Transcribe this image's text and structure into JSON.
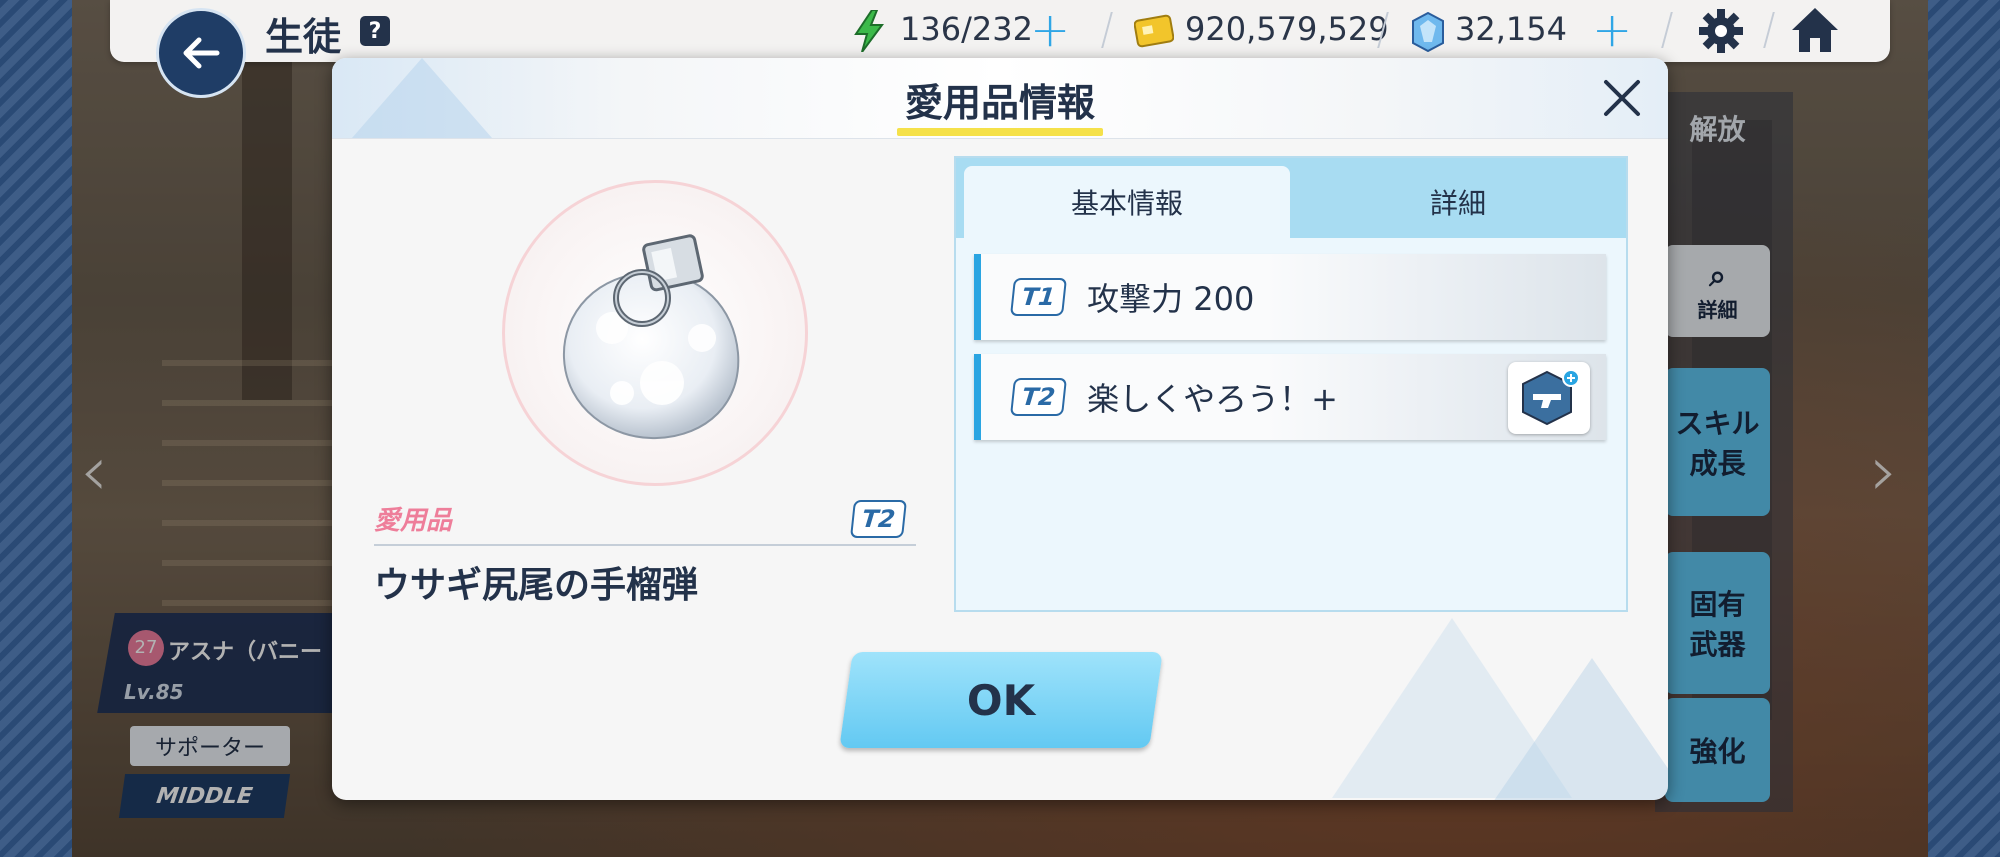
{
  "header": {
    "title": "生徒",
    "help": "?",
    "ap": "136/232",
    "credits": "920,579,529",
    "gems": "32,154"
  },
  "background": {
    "side_release": "解放",
    "side_detail": "詳細",
    "side_skill": "スキル\n成長",
    "side_weapon": "固有\n武器",
    "side_enhance": "強化",
    "character_level_badge": "27",
    "character_name": "アスナ（バニー",
    "character_level": "Lv.85",
    "supporter_label": "サポーター",
    "position_label": "MIDDLE"
  },
  "modal": {
    "title": "愛用品情報",
    "category_label": "愛用品",
    "tier_tag": "T2",
    "item_name": "ウサギ尻尾の手榴弾",
    "tabs": [
      {
        "label": "基本情報",
        "active": true
      },
      {
        "label": "詳細",
        "active": false
      }
    ],
    "stats": [
      {
        "tier": "T1",
        "text": "攻撃力 200"
      },
      {
        "tier": "T2",
        "text": "楽しくやろう！+"
      }
    ],
    "ok_label": "OK"
  },
  "colors": {
    "accent_blue": "#2aa5e2",
    "title_underline": "#f5e14a",
    "category_pink": "#ee7e9a",
    "dark_text": "#23324a"
  }
}
